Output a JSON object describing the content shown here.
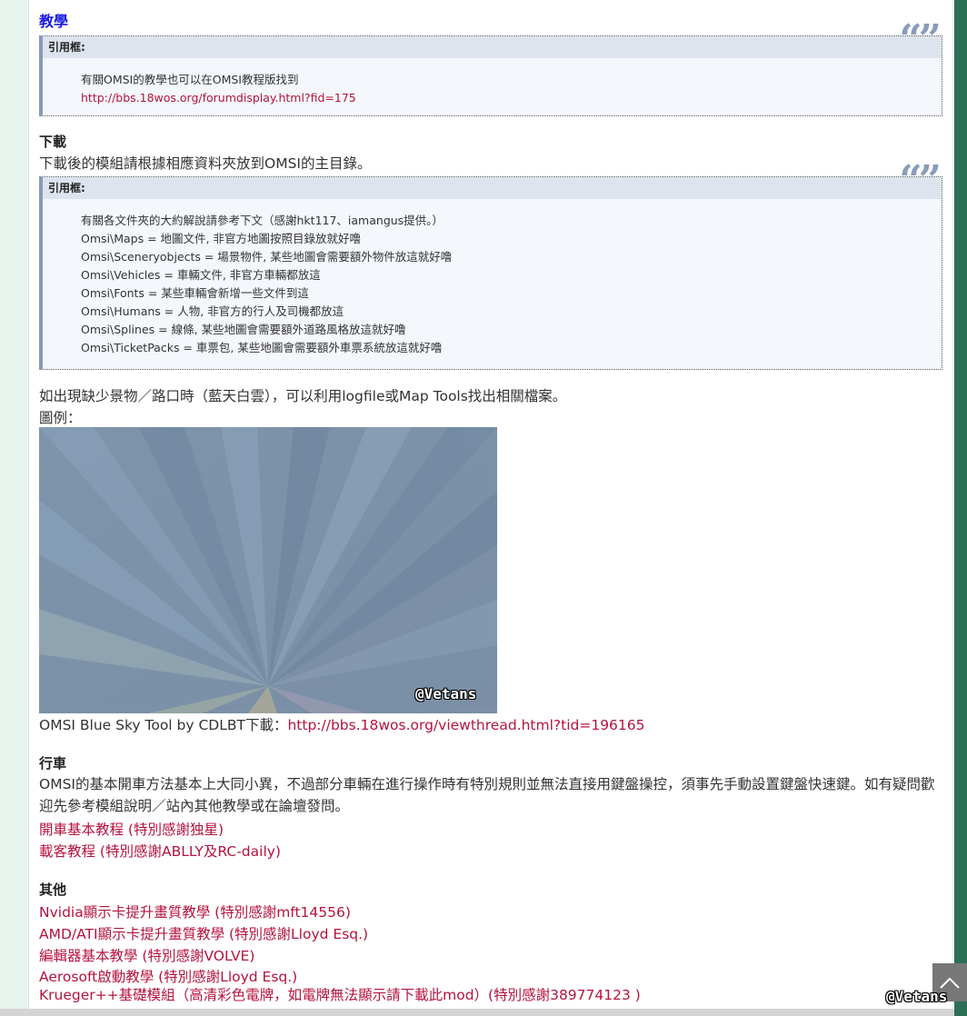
{
  "tutorial": {
    "title": "教學"
  },
  "quote_label": "引用框:",
  "quote1": {
    "text": "有關OMSI的教學也可以在OMSI教程版找到",
    "link": "http://bbs.18wos.org/forumdisplay.html?fid=175"
  },
  "download": {
    "title": "下載",
    "desc": "下載後的模組請根據相應資料夾放到OMSI的主目錄。"
  },
  "quote2": {
    "lines": [
      "有關各文件夾的大約解說請參考下文（感謝hkt117、iamangus提供。）",
      "Omsi\\Maps = 地圖文件, 非官方地圖按照目錄放就好噜",
      "Omsi\\Sceneryobjects = 場景物件, 某些地圖會需要額外物件放這就好噜",
      "Omsi\\Vehicles = 車輛文件, 非官方車輛都放這",
      "Omsi\\Fonts = 某些車輛會新增一些文件到這",
      "Omsi\\Humans = 人物, 非官方的行人及司機都放這",
      "Omsi\\Splines = 線條, 某些地圖會需要額外道路風格放這就好噜",
      "Omsi\\TicketPacks = 車票包, 某些地圖會需要額外車票系統放這就好噜"
    ]
  },
  "missing": {
    "text": "如出現缺少景物／路口時（藍天白雲），可以利用logfile或Map Tools找出相關檔案。",
    "example_label": "圖例："
  },
  "image": {
    "watermark": "@Vetans"
  },
  "bluesky": {
    "prefix": "OMSI Blue Sky Tool by CDLBT下載：",
    "link": "http://bbs.18wos.org/viewthread.html?tid=196165"
  },
  "driving": {
    "title": "行車",
    "desc": "OMSI的基本開車方法基本上大同小異，不過部分車輛在進行操作時有特別規則並無法直接用鍵盤操控，須事先手動設置鍵盤快速鍵。如有疑問歡迎先參考模組說明／站內其他教學或在論壇發問。",
    "links": [
      "開車基本教程 (特別感謝独星)",
      "載客教程 (特別感謝ABLLY及RC-daily)"
    ]
  },
  "other": {
    "title": "其他",
    "links": [
      "Nvidia顯示卡提升畫質教學 (特別感謝mft14556)",
      "AMD/ATI顯示卡提升畫質教學 (特別感謝Lloyd Esq.)",
      "編輯器基本教學 (特別感謝VOLVE)",
      "Aerosoft啟動教學 (特別感謝Lloyd Esq.)",
      "Krueger++基礎模組（高清彩色電牌，如電牌無法顯示請下載此mod）(特別感謝389774123 )"
    ]
  },
  "footer_watermark": "@Vetans",
  "icons": {
    "scroll_top": "chevron-up-icon",
    "quote": "quote-icon"
  },
  "colors": {
    "link": "#b5133e",
    "heading_blue": "#1a1ae6",
    "right_strip": "#2d6e57"
  }
}
